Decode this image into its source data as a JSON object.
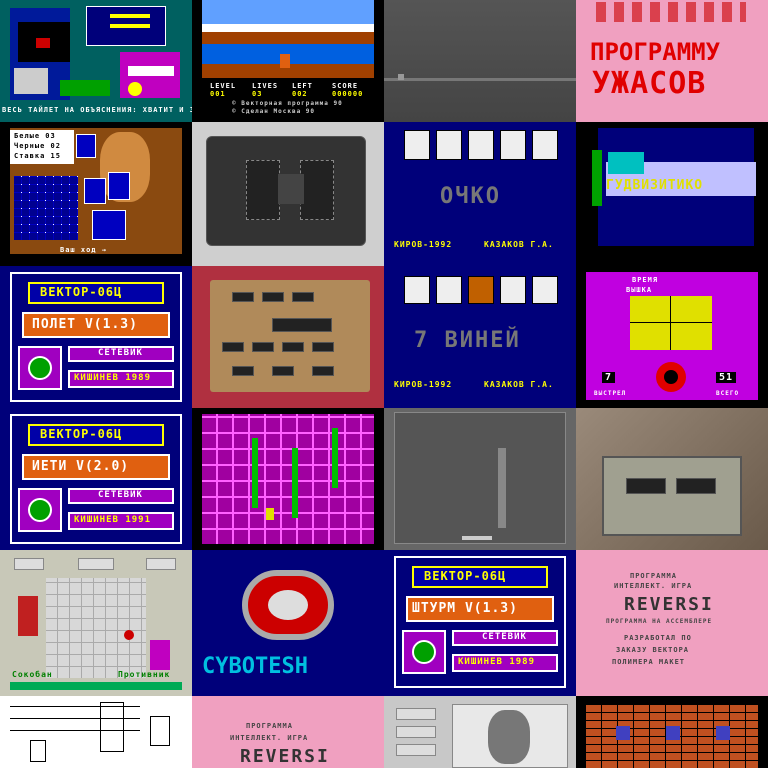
{
  "tiles": {
    "r1c1": {
      "text_lines": [
        "ВЕСЬ ТАЙЛЕТ НА ОБЪЯСНЕНИЯ: ХВАТИТ И ЗАВ"
      ]
    },
    "r1c2": {
      "hud": [
        "LEVEL",
        "LIVES",
        "LEFT",
        "SCORE"
      ],
      "hud_vals": [
        "001",
        "03",
        "002",
        "000000"
      ],
      "credits": [
        "© Векторная программа 90",
        "© Сделан Москва 90"
      ]
    },
    "r1c4": {
      "title": [
        "ПРОГРАММУ",
        "УЖАСОВ"
      ]
    },
    "r2c1": {
      "stats": [
        "Белые 03",
        "Черные 02",
        "Ставка 15"
      ],
      "footer": "Ваш ход →"
    },
    "r2c3": {
      "title": "ОЧКО",
      "footer_left": "КИРОВ-1992",
      "footer_right": "КАЗАКОВ Г.А."
    },
    "r2c4": {
      "banner": "ГУДВИЗИТИКО"
    },
    "r3c1": {
      "title": "ВЕКТОР-06Ц",
      "game": "ПОЛЕТ V(1.3)",
      "brand": "СЕТЕВИК",
      "place": "КИШИНЕВ 1989"
    },
    "r3c3": {
      "title": "7 ВИНЕЙ",
      "footer_left": "КИРОВ-1992",
      "footer_right": "КАЗАКОВ Г.А."
    },
    "r3c4": {
      "top": [
        "ВРЕМЯ",
        "ВЫШКА"
      ],
      "bottom_left": "7",
      "bottom_right": "51",
      "label_left": "ВЫСТРЕЛ",
      "label_right": "ВСЕГО"
    },
    "r4c1": {
      "title": "ВЕКТОР-06Ц",
      "game": "ИЕТИ V(2.0)",
      "brand": "СЕТЕВИК",
      "place": "КИШИНЕВ 1991"
    },
    "r5c1": {
      "left": "Сокобан",
      "right": "Противник"
    },
    "r5c2": {
      "logo": "CYBOTESH"
    },
    "r5c3": {
      "title": "ВЕКТОР-06Ц",
      "game": "ШТУРМ V(1.3)",
      "brand": "СЕТЕВИК",
      "place": "КИШИНЕВ 1989"
    },
    "r5c4": {
      "lines": [
        "ПРОГРАММА",
        "ИНТЕЛЛЕКТ. ИГРА",
        "REVERSI",
        "ПРОГРАММА НА АССЕМБЛЕРЕ",
        "РАЗРАБОТАЛ ПО",
        "ЗАКАЗУ ВЕКТОРА",
        "ПОЛИМЕРА МАКЕТ"
      ]
    },
    "r6c2": {
      "lines": [
        "ПРОГРАММА",
        "ИНТЕЛЛЕКТ. ИГРА",
        "REVERSI"
      ]
    }
  },
  "colors": {
    "vec_blue": "#0000a8",
    "vec_orange": "#e06010",
    "vec_purple": "#a000c0",
    "vec_green": "#00a000",
    "pink": "#f0a0c0",
    "navy": "#00007a"
  }
}
